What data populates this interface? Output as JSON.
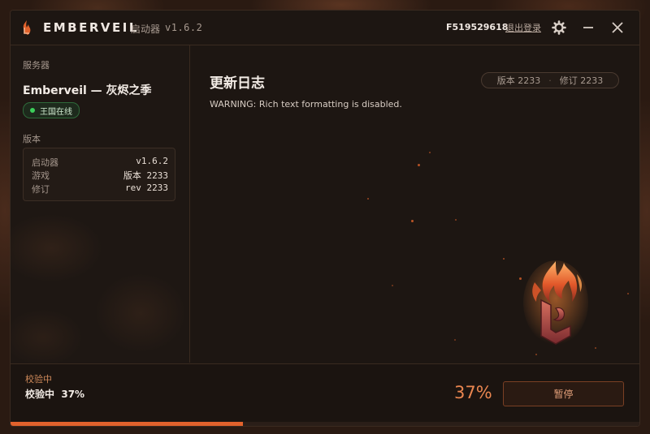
{
  "titlebar": {
    "brand": "EMBERVEIL",
    "launcher_label": "启动器",
    "launcher_version": "v1.6.2",
    "user_id": "F519529618",
    "logout": "退出登录"
  },
  "sidebar": {
    "server_section_label": "服务器",
    "server_name": "Emberveil — 灰烬之季",
    "status": "王国在线",
    "version_section_label": "版本",
    "info_rows": [
      {
        "key": "启动器",
        "value": "v1.6.2"
      },
      {
        "key": "游戏",
        "value": "版本 2233"
      },
      {
        "key": "修订",
        "value": "rev 2233"
      }
    ]
  },
  "main": {
    "title": "更新日志",
    "version_pill": {
      "version": "版本 2233",
      "separator": "·",
      "revision": "修订 2233"
    },
    "warning": "WARNING: Rich text formatting is disabled."
  },
  "bottom": {
    "label": "校验中",
    "status": "校验中  37%",
    "percent": "37%",
    "pause_button": "暂停",
    "progress": 0.37
  },
  "colors": {
    "accent": "#e2622c",
    "online": "#3ccf5a",
    "background": "#1d1612"
  }
}
